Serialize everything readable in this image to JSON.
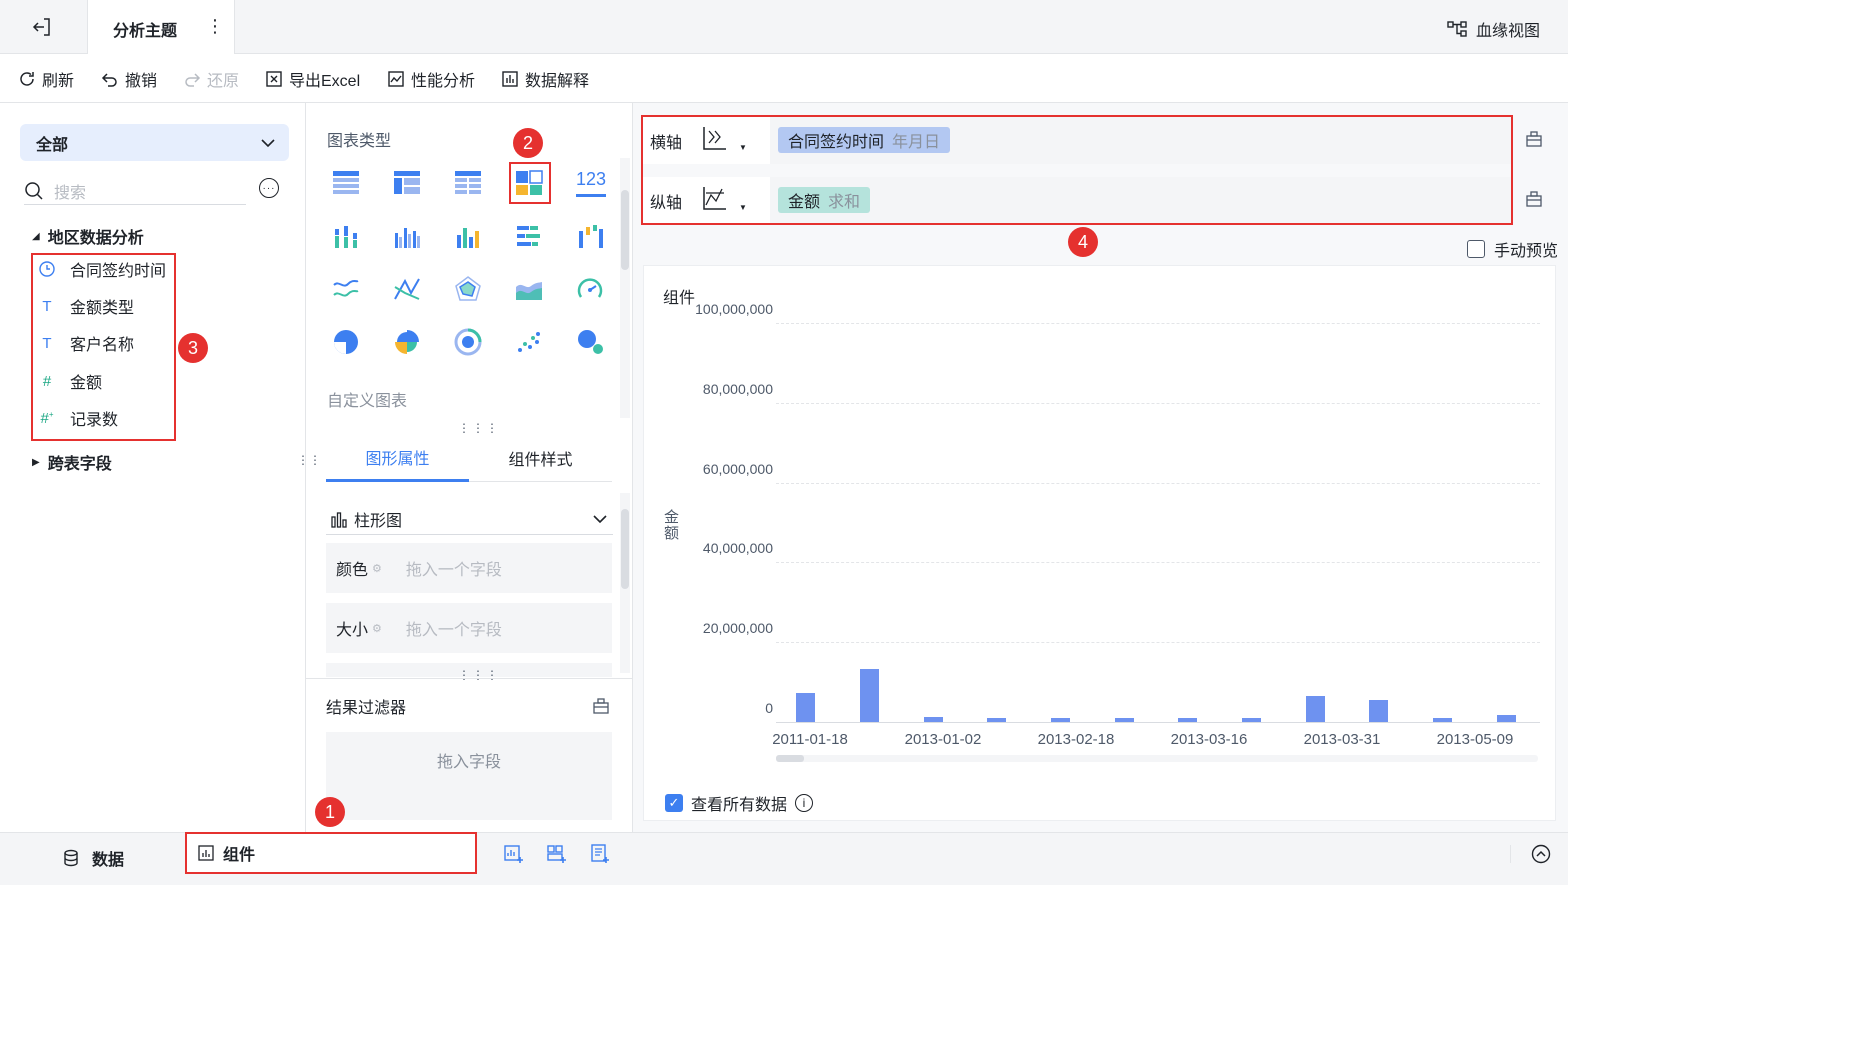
{
  "topbar": {
    "title": "分析主题",
    "lineage_label": "血缘视图"
  },
  "toolbar": {
    "refresh": "刷新",
    "undo": "撤销",
    "redo": "还原",
    "export_excel": "导出Excel",
    "performance": "性能分析",
    "data_explain": "数据解释"
  },
  "left_panel": {
    "scope_select": "全部",
    "search_placeholder": "搜索",
    "group_title": "地区数据分析",
    "fields": [
      {
        "label": "合同签约时间",
        "icon": "clock-icon"
      },
      {
        "label": "金额类型",
        "icon": "text-type-icon"
      },
      {
        "label": "客户名称",
        "icon": "text-type-icon"
      },
      {
        "label": "金额",
        "icon": "number-type-icon"
      },
      {
        "label": "记录数",
        "icon": "count-type-icon"
      }
    ],
    "cross_table": "跨表字段"
  },
  "middle_panel": {
    "chart_type_title": "图表类型",
    "custom_chart": "自定义图表",
    "kpi_label": "123",
    "tabs": {
      "graph_props": "图形属性",
      "component_style": "组件样式"
    },
    "chart_select": "柱形图",
    "color_label": "颜色",
    "size_label": "大小",
    "drop_placeholder": "拖入一个字段",
    "result_filter": "结果过滤器",
    "drop_field": "拖入字段"
  },
  "right_panel": {
    "x_axis_label": "横轴",
    "y_axis_label": "纵轴",
    "x_field": "合同签约时间",
    "x_field_sub": "年月日",
    "y_field": "金额",
    "y_field_sub": "求和",
    "manual_preview": "手动预览",
    "component_title": "组件",
    "view_all_data": "查看所有数据"
  },
  "bottom": {
    "data_tab": "数据",
    "component_tab": "组件"
  },
  "badges": [
    "1",
    "2",
    "3",
    "4"
  ],
  "colors": {
    "accent": "#3d7ff0",
    "bar": "#6e92f0",
    "highlight": "#e5312f",
    "x_pill": "#b3c8f2",
    "y_pill": "#b5e3dc"
  },
  "chart_data": {
    "type": "bar",
    "xlabel": "",
    "ylabel": "金额",
    "ylim": [
      0,
      100000000
    ],
    "yticks": [
      "0",
      "20,000,000",
      "40,000,000",
      "60,000,000",
      "80,000,000",
      "100,000,000"
    ],
    "x_tick_labels": [
      "2011-01-18",
      "2013-01-02",
      "2013-02-18",
      "2013-03-16",
      "2013-03-31",
      "2013-05-09"
    ],
    "values": [
      1200000,
      2200000,
      200000,
      150000,
      150000,
      150000,
      150000,
      150000,
      1100000,
      900000,
      150000,
      300000
    ],
    "grid": true
  }
}
